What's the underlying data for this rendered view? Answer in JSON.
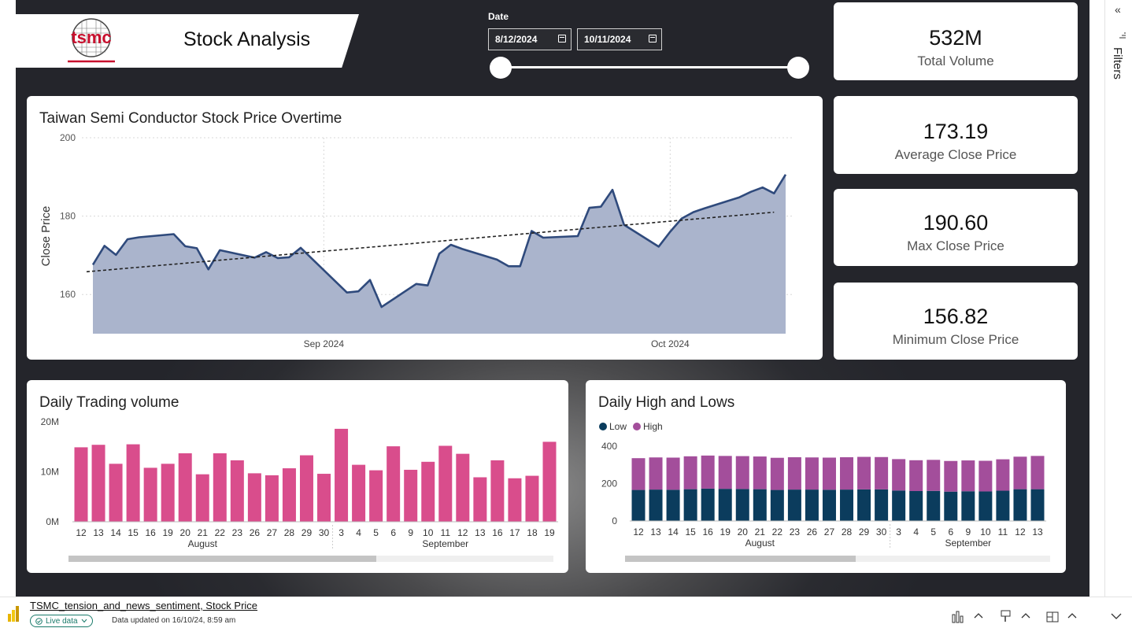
{
  "header": {
    "logo_text": "tsmc",
    "title": "Stock Analysis"
  },
  "date_slicer": {
    "label": "Date",
    "start": "8/12/2024",
    "end": "10/11/2024"
  },
  "kpis": [
    {
      "value": "532M",
      "label": "Total Volume"
    },
    {
      "value": "173.19",
      "label": "Average Close Price"
    },
    {
      "value": "190.60",
      "label": "Max Close Price"
    },
    {
      "value": "156.82",
      "label": "Minimum Close Price"
    }
  ],
  "colors": {
    "area_fill": "#aab4cc",
    "area_line": "#2f4a7c",
    "volume_bar": "#d94d8c",
    "low_bar": "#0b3c5d",
    "high_bar": "#a34e9b"
  },
  "price_chart": {
    "title": "Taiwan Semi Conductor Stock Price Overtime"
  },
  "volume_chart": {
    "title": "Daily Trading volume"
  },
  "highlow_chart": {
    "title": "Daily High and Lows"
  },
  "filters_pane": {
    "label": "Filters",
    "collapse_glyph": "«"
  },
  "statusbar": {
    "report_name": "TSMC_tension_and_news_sentiment, Stock Price",
    "live_label": "Live data",
    "updated_text": "Data updated on 16/10/24, 8:59 am"
  },
  "chart_data": [
    {
      "type": "area",
      "title": "Taiwan Semi Conductor Stock Price Overtime",
      "ylabel": "Close Price",
      "xlabel": "",
      "ylim": [
        150,
        200
      ],
      "yticks": [
        160,
        180,
        200
      ],
      "xticks": [
        {
          "label": "Sep 2024",
          "date": "2024-09-01"
        },
        {
          "label": "Oct 2024",
          "date": "2024-10-01"
        }
      ],
      "x_range": [
        "2024-08-12",
        "2024-10-11"
      ],
      "grid": true,
      "trendline": {
        "from": [
          "2024-08-12",
          165.8
        ],
        "to": [
          "2024-10-10",
          181.0
        ],
        "style": "dashed"
      },
      "points": [
        [
          "2024-08-12",
          167.6
        ],
        [
          "2024-08-13",
          172.4
        ],
        [
          "2024-08-14",
          170.1
        ],
        [
          "2024-08-15",
          174.1
        ],
        [
          "2024-08-16",
          174.6
        ],
        [
          "2024-08-19",
          175.4
        ],
        [
          "2024-08-20",
          172.3
        ],
        [
          "2024-08-21",
          171.8
        ],
        [
          "2024-08-22",
          166.4
        ],
        [
          "2024-08-23",
          171.3
        ],
        [
          "2024-08-26",
          169.4
        ],
        [
          "2024-08-27",
          170.8
        ],
        [
          "2024-08-28",
          169.3
        ],
        [
          "2024-08-29",
          169.5
        ],
        [
          "2024-08-30",
          171.9
        ],
        [
          "2024-09-03",
          160.5
        ],
        [
          "2024-09-04",
          160.8
        ],
        [
          "2024-09-05",
          163.7
        ],
        [
          "2024-09-06",
          156.8
        ],
        [
          "2024-09-09",
          162.7
        ],
        [
          "2024-09-10",
          162.3
        ],
        [
          "2024-09-11",
          170.4
        ],
        [
          "2024-09-12",
          172.7
        ],
        [
          "2024-09-13",
          171.6
        ],
        [
          "2024-09-16",
          168.9
        ],
        [
          "2024-09-17",
          167.2
        ],
        [
          "2024-09-18",
          167.2
        ],
        [
          "2024-09-19",
          176.2
        ],
        [
          "2024-09-20",
          174.5
        ],
        [
          "2024-09-23",
          174.9
        ],
        [
          "2024-09-24",
          182.1
        ],
        [
          "2024-09-25",
          182.4
        ],
        [
          "2024-09-26",
          186.7
        ],
        [
          "2024-09-27",
          177.8
        ],
        [
          "2024-09-30",
          172.2
        ],
        [
          "2024-10-01",
          176.0
        ],
        [
          "2024-10-02",
          179.4
        ],
        [
          "2024-10-03",
          181.0
        ],
        [
          "2024-10-04",
          182.0
        ],
        [
          "2024-10-07",
          184.8
        ],
        [
          "2024-10-08",
          186.2
        ],
        [
          "2024-10-09",
          187.3
        ],
        [
          "2024-10-10",
          185.8
        ],
        [
          "2024-10-11",
          190.6
        ]
      ]
    },
    {
      "type": "bar",
      "title": "Daily Trading volume",
      "ylim": [
        0,
        20
      ],
      "yticks": [
        "0M",
        "10M",
        "20M"
      ],
      "grid": false,
      "categories": [
        "12",
        "13",
        "14",
        "15",
        "16",
        "19",
        "20",
        "21",
        "22",
        "23",
        "26",
        "27",
        "28",
        "29",
        "30",
        "3",
        "4",
        "5",
        "6",
        "9",
        "10",
        "11",
        "12",
        "13",
        "16",
        "17",
        "18",
        "19"
      ],
      "month_groups": [
        {
          "label": "August",
          "from": 0,
          "to": 14
        },
        {
          "label": "September",
          "from": 15,
          "to": 27
        }
      ],
      "values": [
        14.9,
        15.4,
        11.6,
        15.5,
        10.8,
        11.6,
        13.7,
        9.5,
        13.7,
        12.3,
        9.7,
        9.3,
        10.7,
        13.3,
        9.6,
        18.6,
        11.4,
        10.3,
        15.1,
        10.4,
        12.0,
        15.2,
        13.6,
        8.9,
        12.3,
        8.7,
        9.2,
        16.0
      ]
    },
    {
      "type": "bar",
      "stacked": true,
      "title": "Daily High and Lows",
      "legend": "top-left",
      "ylim": [
        0,
        400
      ],
      "yticks": [
        0,
        200,
        400
      ],
      "grid": false,
      "categories": [
        "12",
        "13",
        "14",
        "15",
        "16",
        "19",
        "20",
        "21",
        "22",
        "23",
        "26",
        "27",
        "28",
        "29",
        "30",
        "3",
        "4",
        "5",
        "6",
        "9",
        "10",
        "11",
        "12",
        "13"
      ],
      "month_groups": [
        {
          "label": "August",
          "from": 0,
          "to": 14
        },
        {
          "label": "September",
          "from": 15,
          "to": 23
        }
      ],
      "series": [
        {
          "name": "Low",
          "values": [
            166,
            168,
            167,
            170,
            173,
            172,
            171,
            170,
            166,
            168,
            168,
            167,
            168,
            169,
            169,
            163,
            160,
            161,
            157,
            159,
            158,
            162,
            170,
            170
          ]
        },
        {
          "name": "High",
          "values": [
            170,
            172,
            172,
            176,
            177,
            176,
            176,
            175,
            172,
            173,
            172,
            172,
            173,
            174,
            173,
            168,
            165,
            166,
            164,
            165,
            164,
            168,
            174,
            178
          ]
        }
      ]
    }
  ]
}
